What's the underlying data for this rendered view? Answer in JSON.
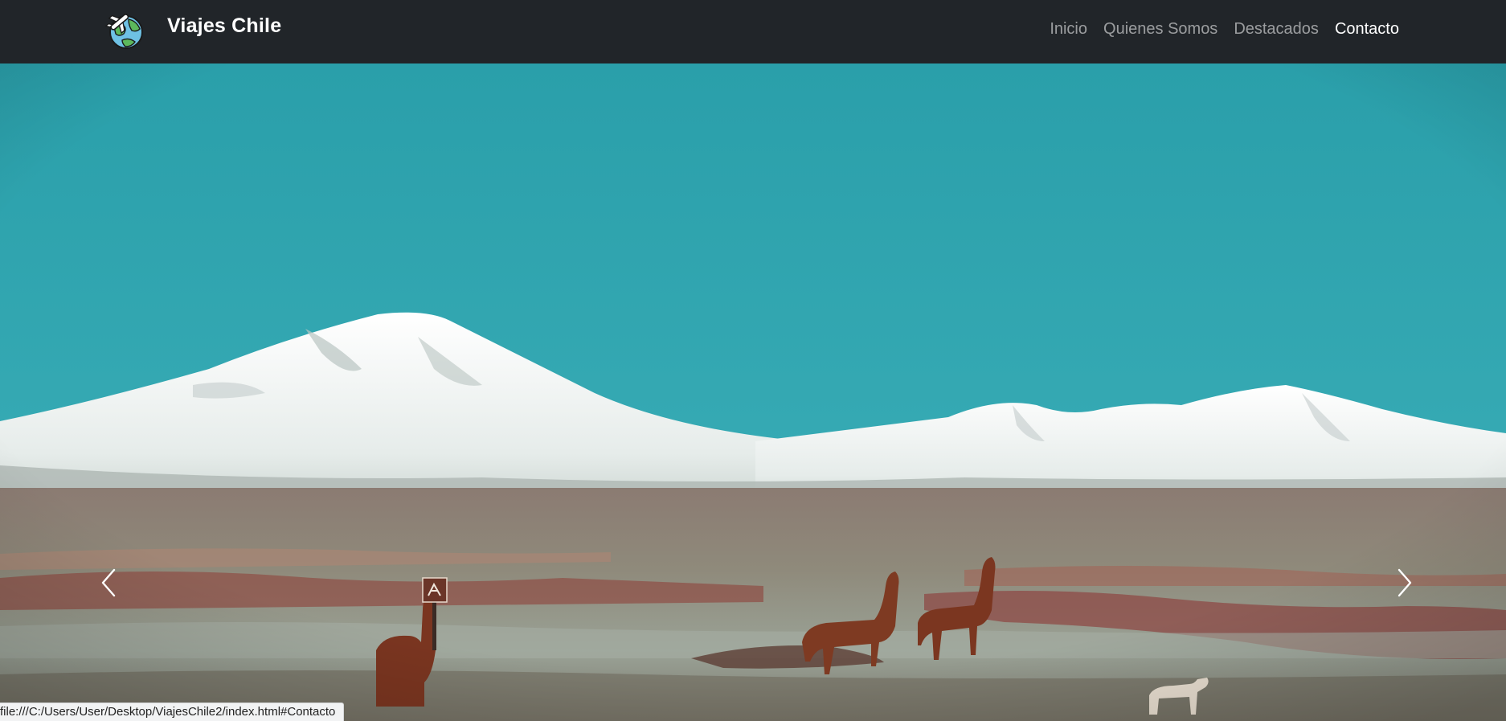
{
  "window": {
    "status_url": "file:///C:/Users/User/Desktop/ViajesChile2/index.html#Contacto"
  },
  "navbar": {
    "brand": {
      "logo_icon": "globe-airplane-icon",
      "name": "Viajes Chile"
    },
    "items": [
      {
        "label": "Inicio",
        "active": false
      },
      {
        "label": "Quienes Somos",
        "active": false
      },
      {
        "label": "Destacados",
        "active": false
      },
      {
        "label": "Contacto",
        "active": true
      }
    ],
    "colors": {
      "background": "#212529",
      "link": "rgba(255,255,255,0.55)",
      "link_active": "#ffffff"
    }
  },
  "carousel": {
    "slide_image": "volcano-llamas-landscape",
    "controls": {
      "prev_icon": "chevron-left-icon",
      "next_icon": "chevron-right-icon"
    },
    "colors": {
      "sky": "#2fa3ad",
      "snow": "#eef3f2",
      "desert": "#8a7c72",
      "llama": "#7a3520"
    }
  }
}
